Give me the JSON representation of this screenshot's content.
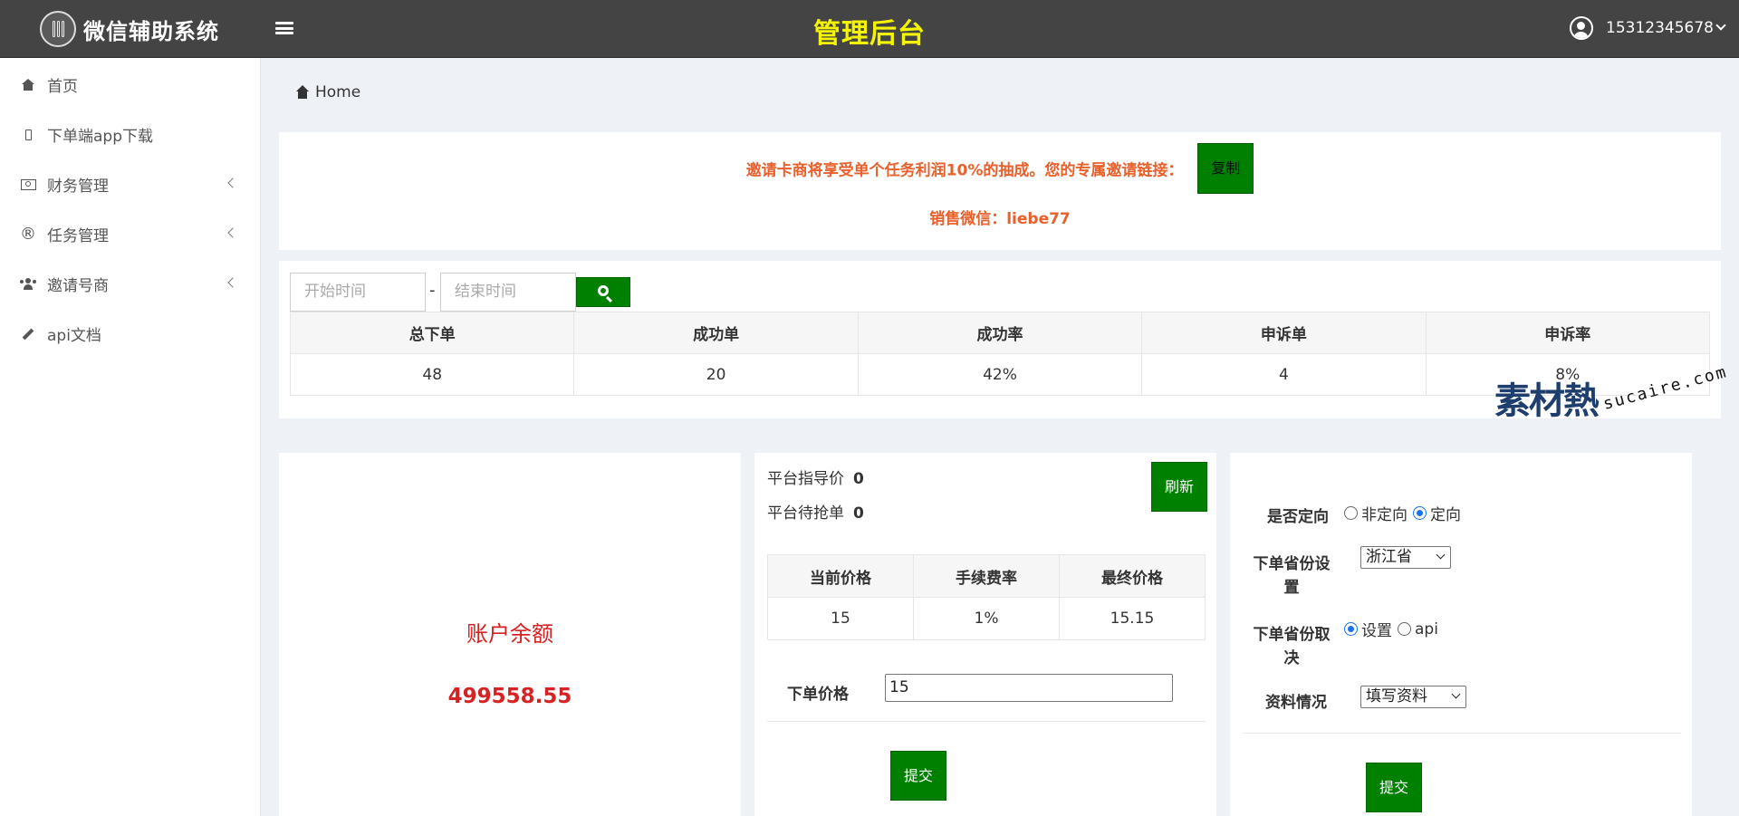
{
  "topbar": {
    "app_name": "微信辅助系统",
    "title": "管理后台",
    "username": "15312345678"
  },
  "sidebar": {
    "items": [
      {
        "label": "首页",
        "icon": "home-icon",
        "has_submenu": false
      },
      {
        "label": "下单端app下载",
        "icon": "mobile-icon",
        "has_submenu": false
      },
      {
        "label": "财务管理",
        "icon": "money-icon",
        "has_submenu": true
      },
      {
        "label": "任务管理",
        "icon": "registered-icon",
        "has_submenu": true
      },
      {
        "label": "邀请号商",
        "icon": "users-icon",
        "has_submenu": true
      },
      {
        "label": "api文档",
        "icon": "pencil-icon",
        "has_submenu": false
      }
    ]
  },
  "breadcrumb": {
    "label": "Home"
  },
  "invite": {
    "text": "邀请卡商将享受单个任务利润10%的抽成。您的专属邀请链接：",
    "copy_label": "复制",
    "sales_wechat": "销售微信：liebe77"
  },
  "filter": {
    "start_placeholder": "开始时间",
    "end_placeholder": "结束时间",
    "separator": "-"
  },
  "stats": {
    "headers": [
      "总下单",
      "成功单",
      "成功率",
      "申诉单",
      "申诉率"
    ],
    "values": [
      "48",
      "20",
      "42%",
      "4",
      "8%"
    ]
  },
  "balance": {
    "label": "账户余额",
    "value": "499558.55"
  },
  "pricing": {
    "guide_price_label": "平台指导价",
    "guide_price_value": "0",
    "pending_label": "平台待抢单",
    "pending_value": "0",
    "refresh_label": "刷新",
    "headers": [
      "当前价格",
      "手续费率",
      "最终价格"
    ],
    "values": [
      "15",
      "1%",
      "15.15"
    ],
    "order_price_label": "下单价格",
    "order_price_value": "15",
    "submit_label": "提交"
  },
  "settings": {
    "targeted_label": "是否定向",
    "targeted_options": [
      "非定向",
      "定向"
    ],
    "targeted_selected": "定向",
    "province_label": "下单省份设置",
    "province_value": "浙江省",
    "province_source_label": "下单省份取决",
    "province_source_options": [
      "设置",
      "api"
    ],
    "province_source_selected": "设置",
    "profile_label": "资料情况",
    "profile_value": "填写资料",
    "submit_label": "提交"
  },
  "watermark": {
    "cn": "素材熱",
    "en": "sucaire.com"
  },
  "colors": {
    "topbar": "#444444",
    "title_yellow": "#f5f500",
    "accent_green": "#008000",
    "invite_orange": "#e8602b",
    "balance_red": "#d62222"
  }
}
